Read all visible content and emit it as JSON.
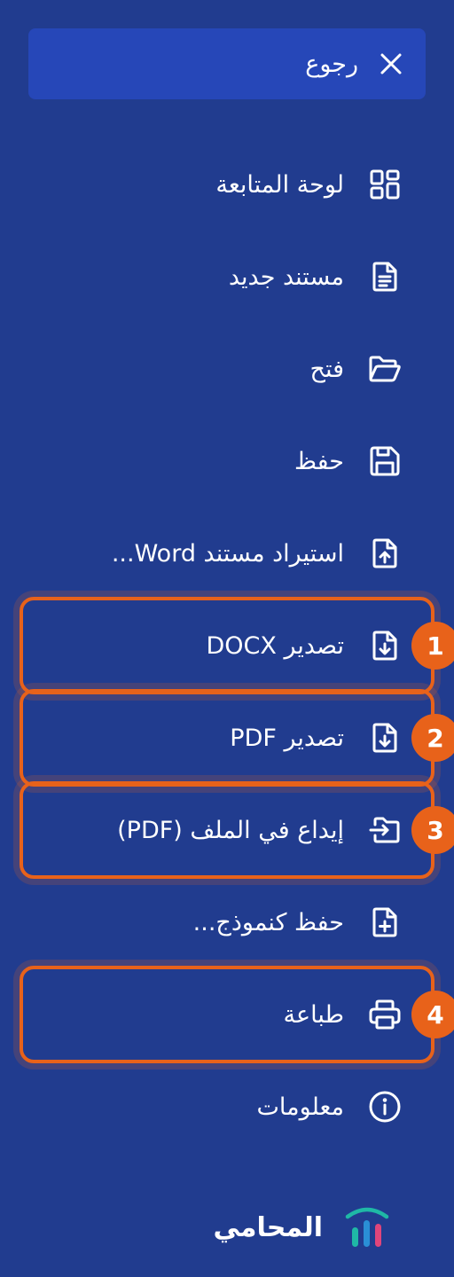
{
  "back": {
    "label": "رجوع",
    "icon": "close-icon"
  },
  "menu": {
    "items": [
      {
        "label": "لوحة المتابعة",
        "icon": "dashboard-grid-icon"
      },
      {
        "label": "مستند جديد",
        "icon": "new-document-icon"
      },
      {
        "label": "فتح",
        "icon": "folder-open-icon"
      },
      {
        "label": "حفظ",
        "icon": "save-icon"
      },
      {
        "label": "استيراد مستند Word...",
        "icon": "file-upload-icon"
      },
      {
        "label": "تصدير DOCX",
        "icon": "file-download-icon"
      },
      {
        "label": "تصدير PDF",
        "icon": "file-download-icon"
      },
      {
        "label": "إيداع في الملف (PDF)",
        "icon": "folder-input-icon"
      },
      {
        "label": "حفظ كنموذج...",
        "icon": "file-plus-icon"
      },
      {
        "label": "طباعة",
        "icon": "printer-icon"
      },
      {
        "label": "معلومات",
        "icon": "info-icon"
      }
    ]
  },
  "annotations": [
    "1",
    "2",
    "3",
    "4"
  ],
  "logo": {
    "name": "المحامي"
  },
  "colors": {
    "background": "#213c8f",
    "back_bar": "#2647b8",
    "highlight": "#e8621a",
    "logo_teal": "#1fb8a6",
    "logo_pink": "#e0457b"
  }
}
